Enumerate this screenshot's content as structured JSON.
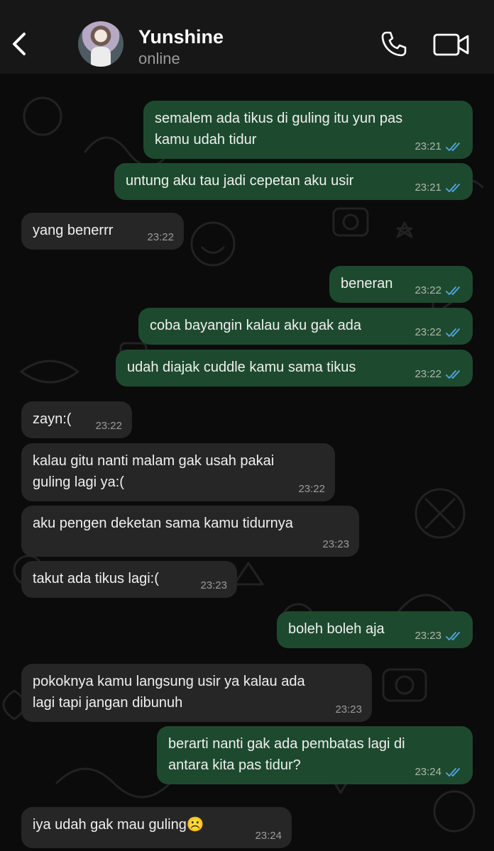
{
  "header": {
    "back_icon": "chevron-left-icon",
    "contact_name": "Yunshine",
    "status": "online",
    "call_icon": "phone-icon",
    "video_icon": "video-camera-icon"
  },
  "colors": {
    "header_bg": "#171717",
    "chat_bg": "#0b0b0b",
    "incoming_bubble": "#262626",
    "outgoing_bubble": "#1d4a2e",
    "read_tick": "#53a6e8"
  },
  "messages": [
    {
      "dir": "out",
      "lines": "semalem ada tikus di guling itu yun pas\nkamu udah tidur",
      "time": "23:21",
      "read": true
    },
    {
      "dir": "out",
      "lines": "untung aku tau jadi cepetan aku usir",
      "time": "23:21",
      "read": true
    },
    {
      "dir": "in",
      "lines": "yang benerrr",
      "time": "23:22"
    },
    {
      "dir": "out",
      "lines": "beneran",
      "time": "23:22",
      "read": true
    },
    {
      "dir": "out",
      "lines": "coba bayangin kalau aku gak ada",
      "time": "23:22",
      "read": true
    },
    {
      "dir": "out",
      "lines": "udah diajak cuddle kamu sama tikus",
      "time": "23:22",
      "read": true
    },
    {
      "dir": "in",
      "lines": "zayn:(",
      "time": "23:22"
    },
    {
      "dir": "in",
      "lines": "kalau gitu nanti malam gak usah pakai\nguling lagi ya:(",
      "time": "23:22"
    },
    {
      "dir": "in",
      "lines": "aku pengen deketan sama kamu tidurnya",
      "time": "23:23"
    },
    {
      "dir": "in",
      "lines": "takut ada tikus lagi:(",
      "time": "23:23"
    },
    {
      "dir": "out",
      "lines": "boleh boleh aja",
      "time": "23:23",
      "read": true
    },
    {
      "dir": "in",
      "lines": "pokoknya kamu langsung usir ya kalau ada\nlagi tapi jangan dibunuh",
      "time": "23:23"
    },
    {
      "dir": "out",
      "lines": "berarti nanti gak ada pembatas lagi di\nantara kita pas tidur?",
      "time": "23:24",
      "read": true
    },
    {
      "dir": "in",
      "lines": "iya udah gak mau guling☹️",
      "time": "23:24"
    }
  ]
}
